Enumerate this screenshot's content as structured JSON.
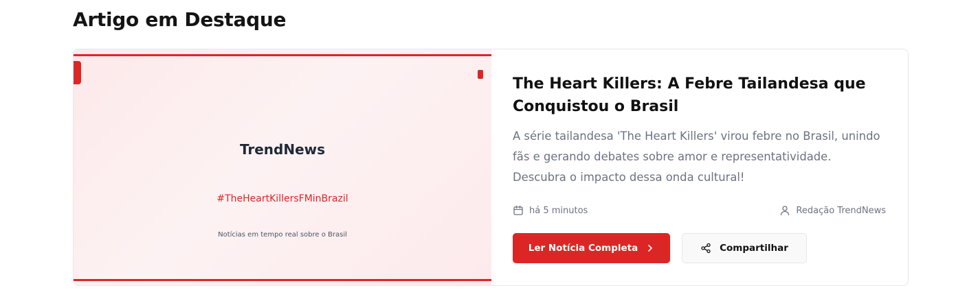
{
  "section": {
    "title": "Artigo em Destaque"
  },
  "featured": {
    "image": {
      "logo_text": "TrendNews",
      "hashtag": "#TheHeartKillersFMinBrazil",
      "tagline": "Notícias em tempo real sobre o Brasil",
      "accent_color": "#dc2626"
    },
    "headline": "The Heart Killers: A Febre Tailandesa que Conquistou o Brasil",
    "summary": "A série tailandesa 'The Heart Killers' virou febre no Brasil, unindo fãs e gerando debates sobre amor e representatividade. Descubra o impacto dessa onda cultural!",
    "meta": {
      "date_icon": "calendar-icon",
      "date": "há 5 minutos",
      "author_icon": "user-icon",
      "author": "Redação TrendNews"
    },
    "actions": {
      "read_label": "Ler Notícia Completa",
      "read_icon": "chevron-right-icon",
      "share_label": "Compartilhar",
      "share_icon": "share-icon"
    }
  }
}
